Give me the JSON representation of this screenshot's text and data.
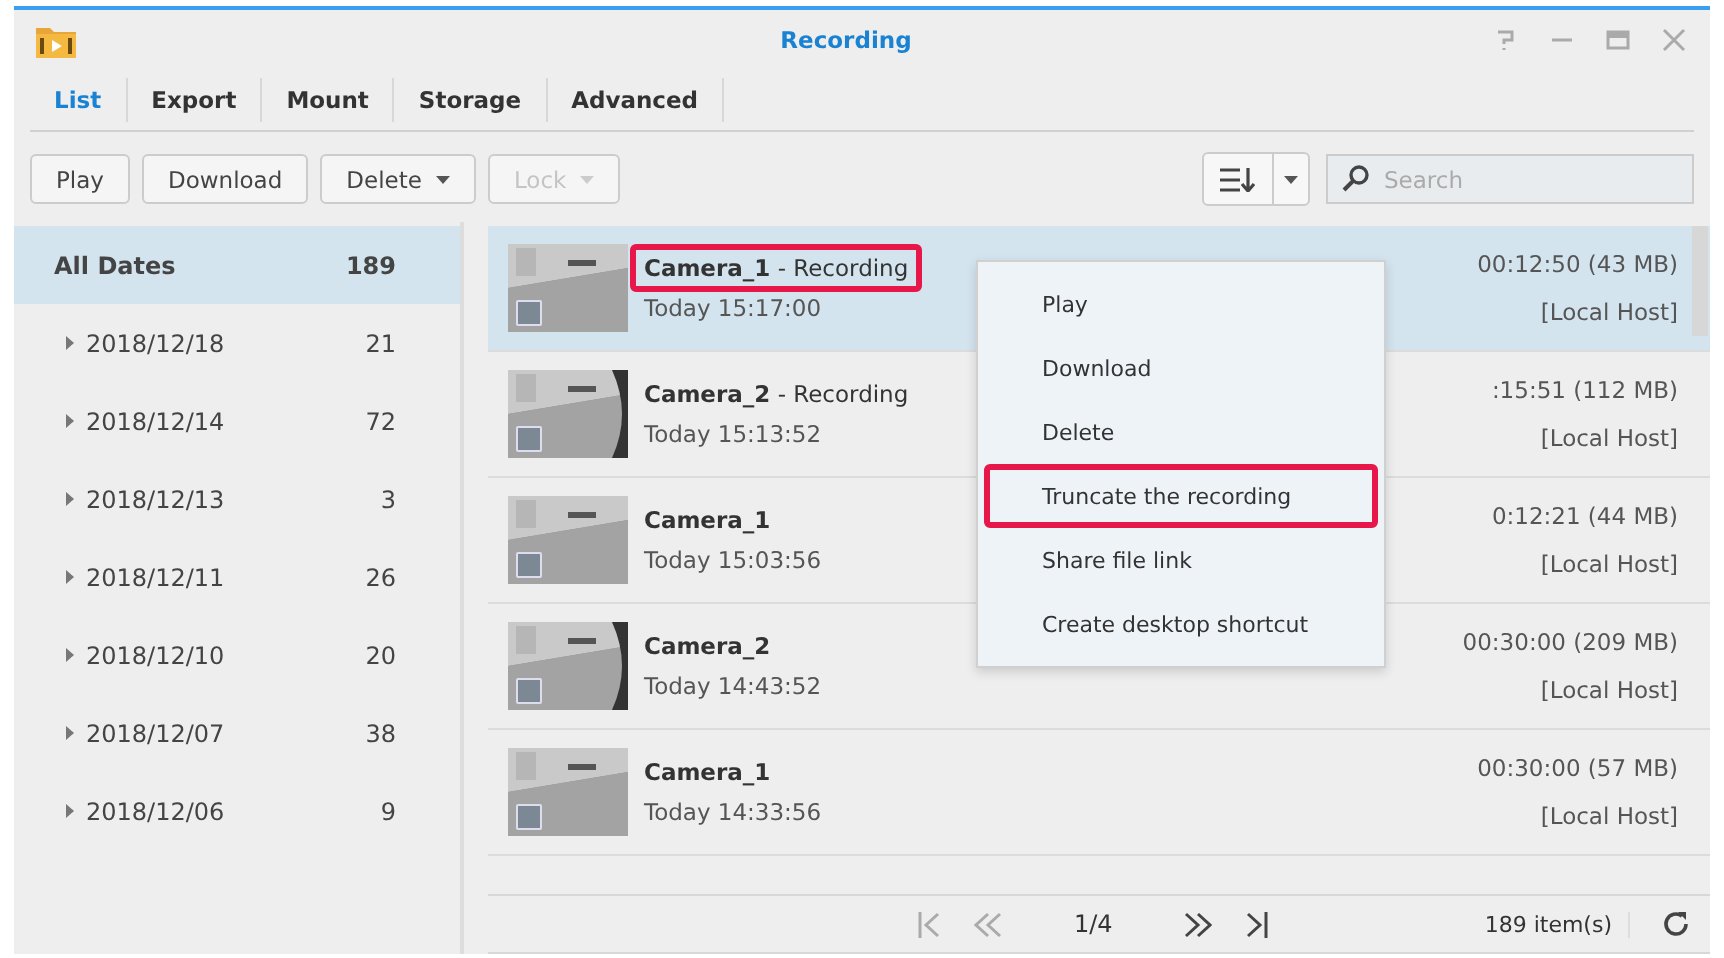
{
  "window": {
    "title": "Recording"
  },
  "tabs": [
    {
      "label": "List",
      "selected": true
    },
    {
      "label": "Export",
      "selected": false
    },
    {
      "label": "Mount",
      "selected": false
    },
    {
      "label": "Storage",
      "selected": false
    },
    {
      "label": "Advanced",
      "selected": false
    }
  ],
  "toolbar": {
    "buttons": [
      {
        "label": "Play",
        "dropdown": false,
        "disabled": false
      },
      {
        "label": "Download",
        "dropdown": false,
        "disabled": false
      },
      {
        "label": "Delete",
        "dropdown": true,
        "disabled": false
      },
      {
        "label": "Lock",
        "dropdown": true,
        "disabled": true
      }
    ],
    "search": {
      "placeholder": "Search"
    }
  },
  "sidebar": {
    "items": [
      {
        "label": "All Dates",
        "count": "189",
        "selected": true,
        "expandable": false
      },
      {
        "label": "2018/12/18",
        "count": "21",
        "selected": false,
        "expandable": true
      },
      {
        "label": "2018/12/14",
        "count": "72",
        "selected": false,
        "expandable": true
      },
      {
        "label": "2018/12/13",
        "count": "3",
        "selected": false,
        "expandable": true
      },
      {
        "label": "2018/12/11",
        "count": "26",
        "selected": false,
        "expandable": true
      },
      {
        "label": "2018/12/10",
        "count": "20",
        "selected": false,
        "expandable": true
      },
      {
        "label": "2018/12/07",
        "count": "38",
        "selected": false,
        "expandable": true
      },
      {
        "label": "2018/12/06",
        "count": "9",
        "selected": false,
        "expandable": true
      }
    ]
  },
  "recordings": [
    {
      "title": "**Camera_1** - Recording",
      "time": "Today 15:17:00",
      "duration": "00:12:50 (43 MB)",
      "host": "[Local Host]",
      "selected": true,
      "highlighted": true
    },
    {
      "title": "**Camera_2** - Recording",
      "time": "Today 15:13:52",
      "duration": ":15:51 (112 MB)",
      "host": "[Local Host]",
      "selected": false,
      "highlighted": false
    },
    {
      "title": "**Camera_1**",
      "time": "Today 15:03:56",
      "duration": "0:12:21 (44 MB)",
      "host": "[Local Host]",
      "selected": false,
      "highlighted": false
    },
    {
      "title": "**Camera_2**",
      "time": "Today 14:43:52",
      "duration": "00:30:00 (209 MB)",
      "host": "[Local Host]",
      "selected": false,
      "highlighted": false
    },
    {
      "title": "**Camera_1**",
      "time": "Today 14:33:56",
      "duration": "00:30:00 (57 MB)",
      "host": "[Local Host]",
      "selected": false,
      "highlighted": false
    }
  ],
  "context_menu": {
    "items": [
      {
        "label": "Play",
        "highlighted": false
      },
      {
        "label": "Download",
        "highlighted": false
      },
      {
        "label": "Delete",
        "highlighted": false
      },
      {
        "label": "Truncate the recording",
        "highlighted": true
      },
      {
        "label": "Share file link",
        "highlighted": false
      },
      {
        "label": "Create desktop shortcut",
        "highlighted": false
      }
    ]
  },
  "pager": {
    "page": "1/4",
    "total": "189 item(s)"
  }
}
